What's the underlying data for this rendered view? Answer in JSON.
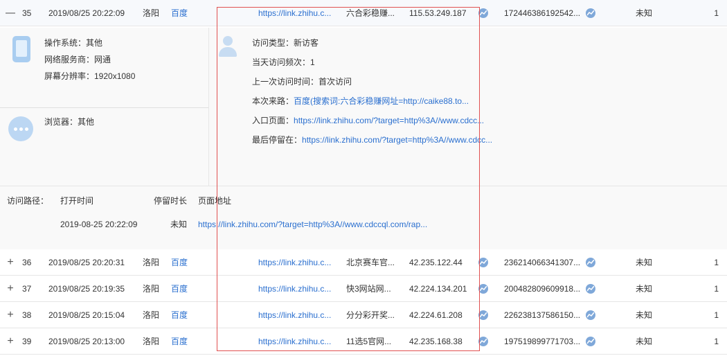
{
  "rows": [
    {
      "toggle": "—",
      "index": "35",
      "time": "2019/08/25 20:22:09",
      "city": "洛阳",
      "source": "百度",
      "landing": "https://link.zhihu.c...",
      "keyword": "六合彩稳赚...",
      "ip": "115.53.249.187",
      "visitor_id": "172446386192542...",
      "status": "未知",
      "count": "1"
    },
    {
      "toggle": "+",
      "index": "36",
      "time": "2019/08/25 20:20:31",
      "city": "洛阳",
      "source": "百度",
      "landing": "https://link.zhihu.c...",
      "keyword": "北京赛车官...",
      "ip": "42.235.122.44",
      "visitor_id": "236214066341307...",
      "status": "未知",
      "count": "1"
    },
    {
      "toggle": "+",
      "index": "37",
      "time": "2019/08/25 20:19:35",
      "city": "洛阳",
      "source": "百度",
      "landing": "https://link.zhihu.c...",
      "keyword": "快3网站网...",
      "ip": "42.224.134.201",
      "visitor_id": "200482809609918...",
      "status": "未知",
      "count": "1"
    },
    {
      "toggle": "+",
      "index": "38",
      "time": "2019/08/25 20:15:04",
      "city": "洛阳",
      "source": "百度",
      "landing": "https://link.zhihu.c...",
      "keyword": "分分彩开奖...",
      "ip": "42.224.61.208",
      "visitor_id": "226238137586150...",
      "status": "未知",
      "count": "1"
    },
    {
      "toggle": "+",
      "index": "39",
      "time": "2019/08/25 20:13:00",
      "city": "洛阳",
      "source": "百度",
      "landing": "https://link.zhihu.c...",
      "keyword": "11选5官网...",
      "ip": "42.235.168.38",
      "visitor_id": "197519899771703...",
      "status": "未知",
      "count": "1"
    }
  ],
  "detail": {
    "os": "操作系统：其他",
    "isp": "网络服务商：网通",
    "resolution": "屏幕分辨率：1920x1080",
    "browser": "浏览器：其他",
    "visit_type": "访问类型：新访客",
    "daily_freq": "当天访问频次：1",
    "last_visit": "上一次访问时间：首次访问",
    "source_label": "本次来路：",
    "source_value": "百度(搜索词:六合彩稳赚网址=http://caike88.to...",
    "entry_label": "入口页面：",
    "entry_value": "https://link.zhihu.com/?target=http%3A//www.cdcc...",
    "last_page_label": "最后停留在：",
    "last_page_value": "https://link.zhihu.com/?target=http%3A//www.cdcc..."
  },
  "path": {
    "label": "访问路径：",
    "col_open_time": "打开时间",
    "col_duration": "停留时长",
    "col_url": "页面地址",
    "open_time": "2019-08-25 20:22:09",
    "duration": "未知",
    "url": "https://link.zhihu.com/?target=http%3A//www.cdccql.com/rap..."
  },
  "icons": {
    "trend": "trend-icon",
    "phone": "mobile-device-icon",
    "browser": "browser-more-icon",
    "user": "user-icon"
  },
  "colors": {
    "link": "#2a6fcf",
    "highlight_box": "#e05050"
  }
}
